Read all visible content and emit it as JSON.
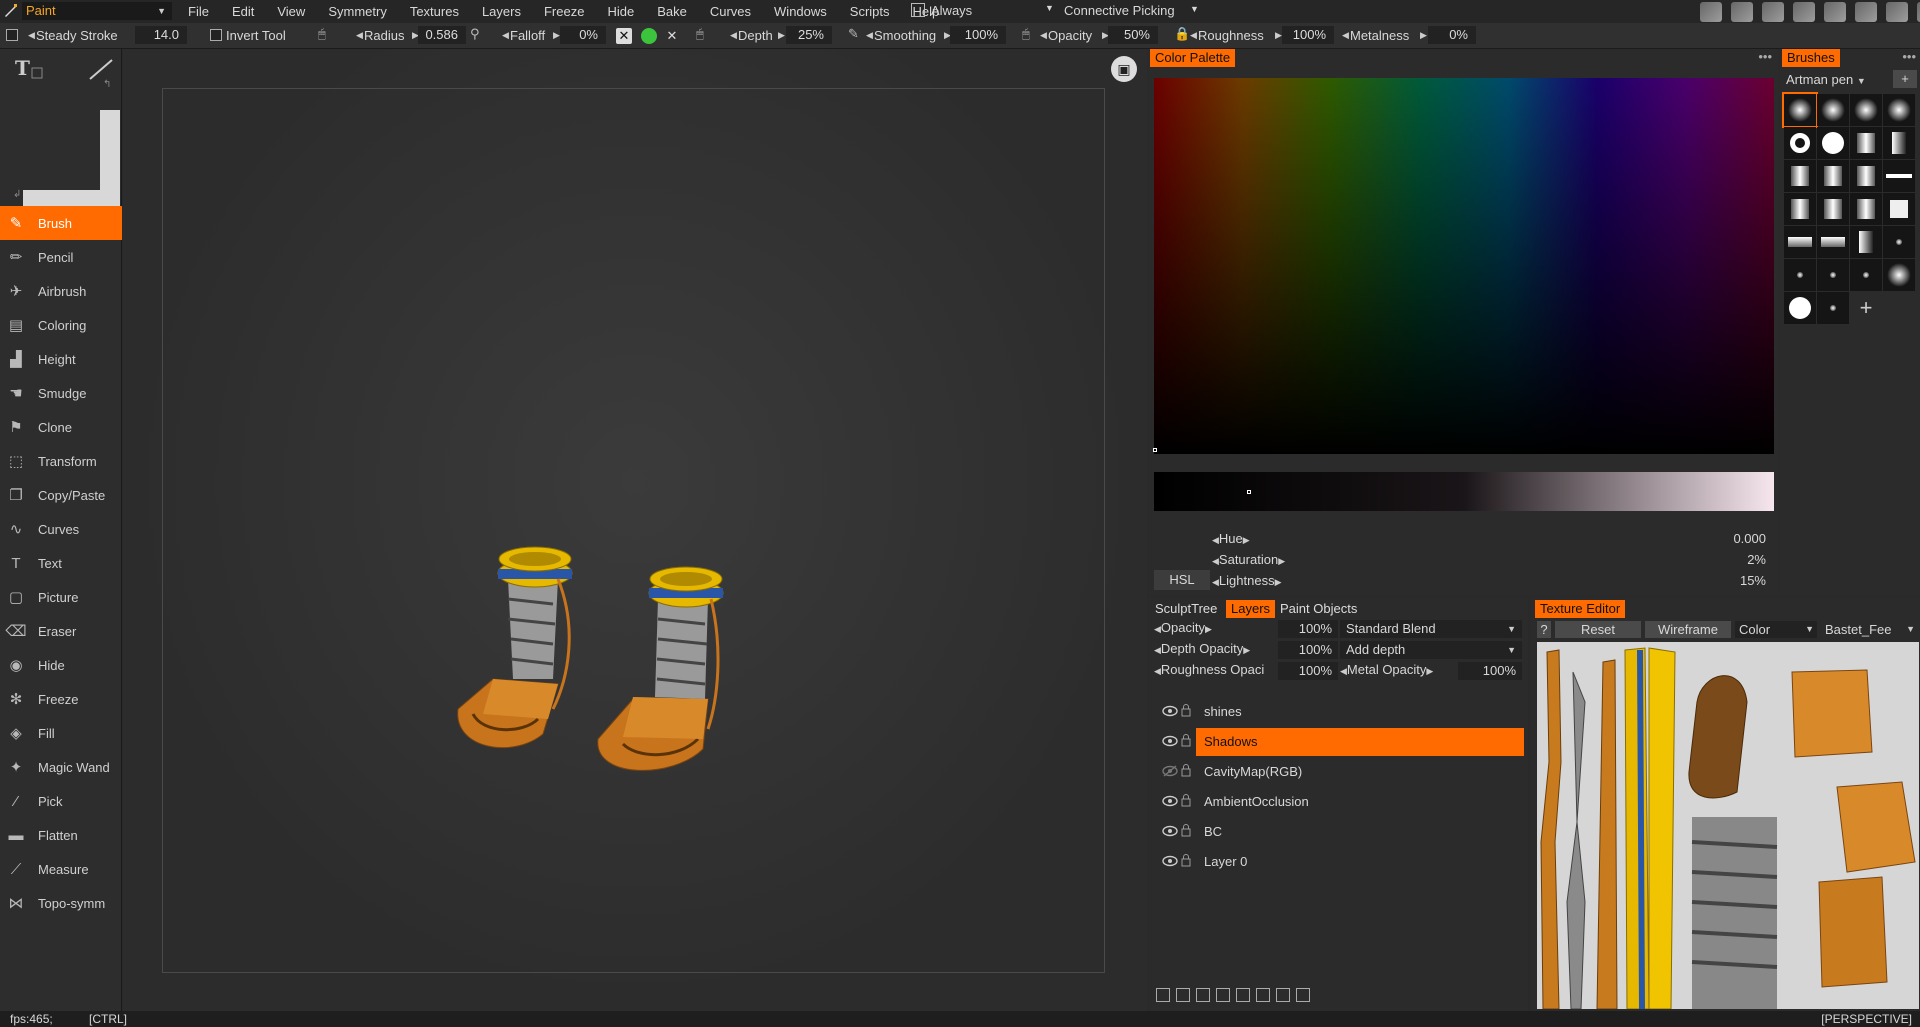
{
  "app": {
    "mode": "Paint"
  },
  "menu": [
    "File",
    "Edit",
    "View",
    "Symmetry",
    "Textures",
    "Layers",
    "Freeze",
    "Hide",
    "Bake",
    "Curves",
    "Windows",
    "Scripts",
    "Help"
  ],
  "menubar_extra": {
    "always_label": "Always",
    "picking_label": "Connective Picking"
  },
  "options": {
    "steady_stroke_label": "Steady Stroke",
    "steady_stroke_value": "14.0",
    "invert_tool_label": "Invert Tool",
    "radius_label": "Radius",
    "radius_value": "0.586",
    "falloff_label": "Falloff",
    "falloff_value": "0%",
    "depth_label": "Depth",
    "depth_value": "25%",
    "smoothing_label": "Smoothing",
    "smoothing_value": "100%",
    "opacity_label": "Opacity",
    "opacity_value": "50%",
    "roughness_label": "Roughness",
    "roughness_value": "100%",
    "metalness_label": "Metalness",
    "metalness_value": "0%"
  },
  "tools": [
    "Brush",
    "Pencil",
    "Airbrush",
    "Coloring",
    "Height",
    "Smudge",
    "Clone",
    "Transform",
    "Copy/Paste",
    "Curves",
    "Text",
    "Picture",
    "Eraser",
    "Hide",
    "Freeze",
    "Fill",
    "Magic Wand",
    "Pick",
    "Flatten",
    "Measure",
    "Topo-symm"
  ],
  "active_tool": "Brush",
  "color_palette": {
    "tab": "Color Palette",
    "hue_label": "Hue",
    "hue_value": "0.000",
    "saturation_label": "Saturation",
    "saturation_value": "2%",
    "lightness_label": "Lightness",
    "lightness_value": "15%",
    "mode_button": "HSL"
  },
  "brushes": {
    "tab": "Brushes",
    "set_name": "Artman pen",
    "add": "+"
  },
  "layers_panel": {
    "tabs": [
      "SculptTree",
      "Layers",
      "Paint Objects"
    ],
    "active_tab": "Layers",
    "opacity_label": "Opacity",
    "opacity_value": "100%",
    "blend_mode": "Standard Blend",
    "depth_opacity_label": "Depth Opacity",
    "depth_opacity_value": "100%",
    "depth_mode": "Add depth",
    "roughness_opacity_label": "Roughness Opaci",
    "roughness_opacity_value": "100%",
    "metal_opacity_label": "Metal Opacity",
    "metal_opacity_value": "100%",
    "layers": [
      {
        "name": "shines",
        "visible": true,
        "selected": false
      },
      {
        "name": "Shadows",
        "visible": true,
        "selected": true
      },
      {
        "name": "CavityMap(RGB)",
        "visible": false,
        "selected": false
      },
      {
        "name": "AmbientOcclusion",
        "visible": true,
        "selected": false
      },
      {
        "name": "BC",
        "visible": true,
        "selected": false
      },
      {
        "name": "Layer 0",
        "visible": true,
        "selected": false
      }
    ]
  },
  "texture_editor": {
    "tab": "Texture Editor",
    "help": "?",
    "reset": "Reset",
    "wireframe": "Wireframe",
    "channel": "Color",
    "texture": "Bastet_Fee"
  },
  "status": {
    "fps": "fps:465;",
    "key": "[CTRL]",
    "view": "[PERSPECTIVE]"
  },
  "colors": {
    "accent": "#ff6b00",
    "gold": "#e6b800",
    "blue": "#2a56a8",
    "leather": "#c87a1e",
    "metal": "#8a8a8a"
  }
}
